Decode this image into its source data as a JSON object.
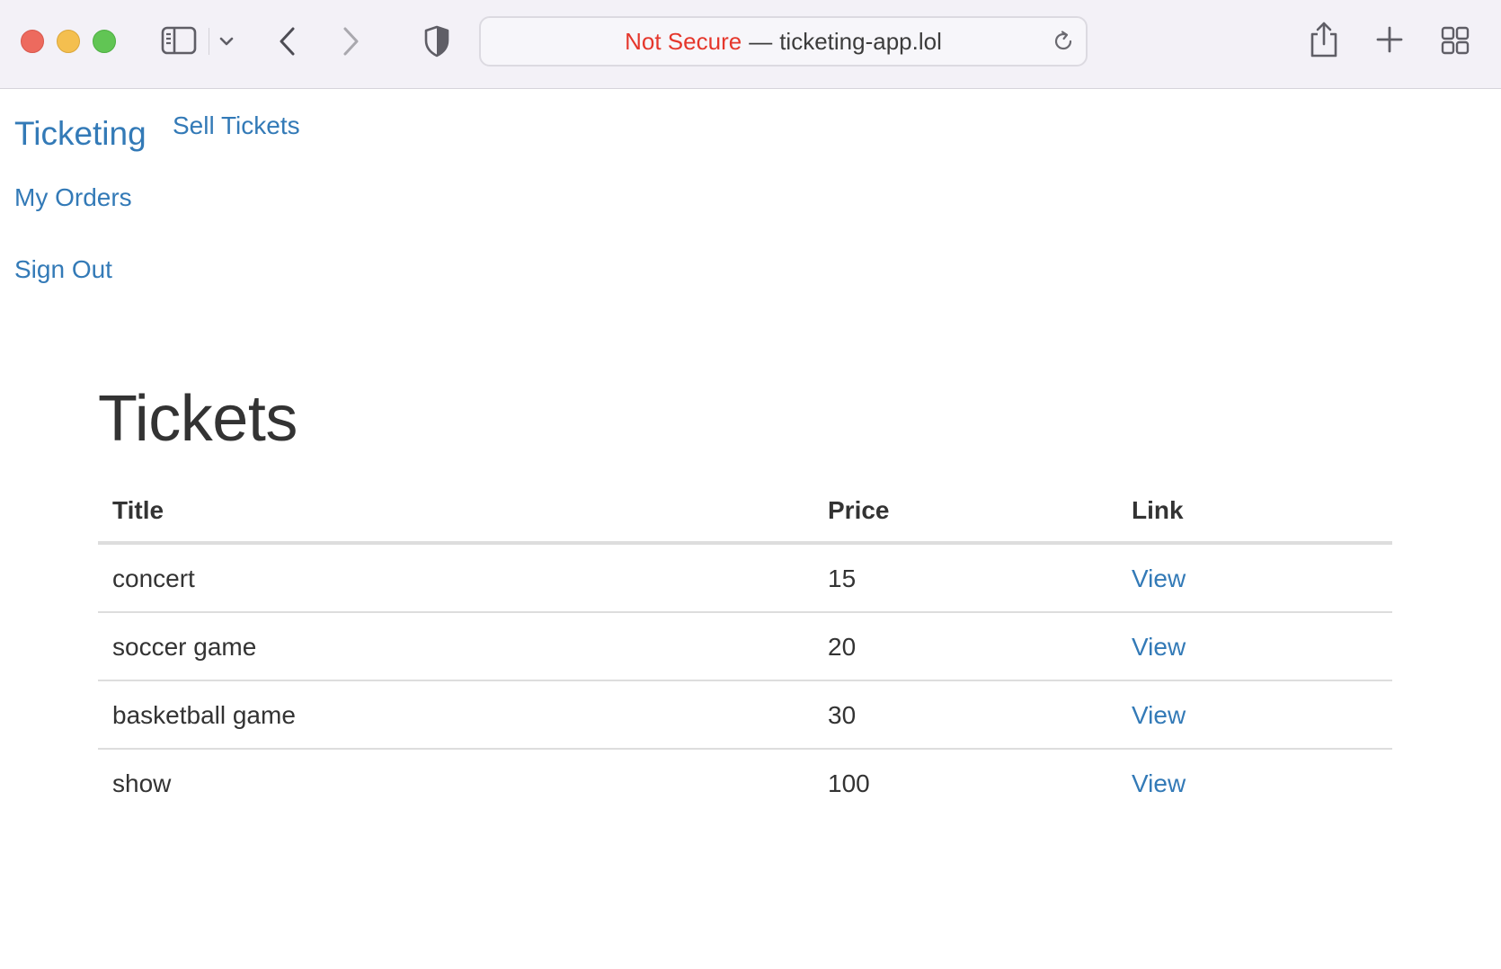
{
  "browser": {
    "address": {
      "security_label": "Not Secure",
      "separator": "—",
      "host": "ticketing-app.lol"
    },
    "icons": [
      "sidebar-icon",
      "chevron-down-icon",
      "back-icon",
      "forward-icon",
      "shield-icon",
      "reload-icon",
      "share-icon",
      "plus-icon",
      "tab-overview-icon"
    ]
  },
  "nav": {
    "brand": "Ticketing",
    "links": [
      {
        "label": "Sell Tickets"
      },
      {
        "label": "My Orders"
      },
      {
        "label": "Sign Out"
      }
    ]
  },
  "main": {
    "title": "Tickets",
    "table": {
      "headers": [
        "Title",
        "Price",
        "Link"
      ],
      "rows": [
        {
          "title": "concert",
          "price": "15",
          "link": "View"
        },
        {
          "title": "soccer game",
          "price": "20",
          "link": "View"
        },
        {
          "title": "basketball game",
          "price": "30",
          "link": "View"
        },
        {
          "title": "show",
          "price": "100",
          "link": "View"
        }
      ]
    }
  },
  "colors": {
    "link": "#337ab7",
    "not_secure": "#e5372c",
    "text": "#333333"
  }
}
